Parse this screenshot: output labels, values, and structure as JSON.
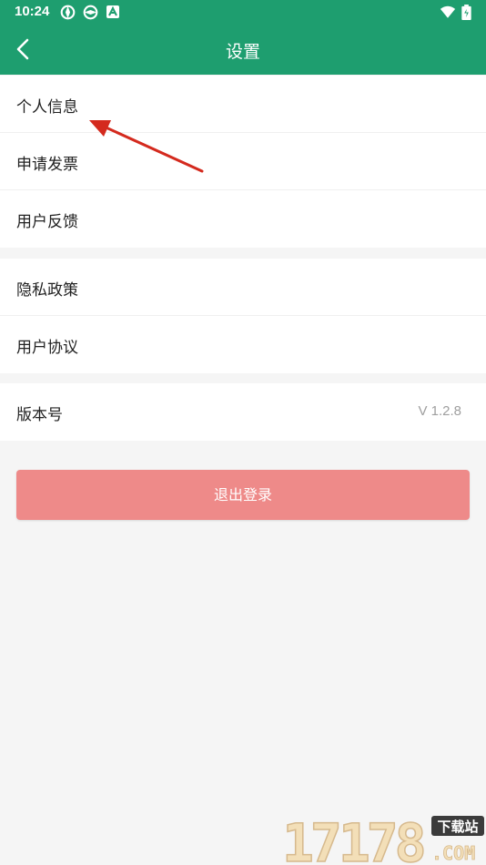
{
  "status_bar": {
    "time": "10:24"
  },
  "app_bar": {
    "title": "设置",
    "back_icon": "chevron-left-icon"
  },
  "groups": [
    {
      "items": [
        {
          "label": "个人信息"
        },
        {
          "label": "申请发票"
        },
        {
          "label": "用户反馈"
        }
      ]
    },
    {
      "items": [
        {
          "label": "隐私政策"
        },
        {
          "label": "用户协议"
        }
      ]
    },
    {
      "items": [
        {
          "label": "版本号",
          "value": "V 1.2.8"
        }
      ]
    }
  ],
  "logout_label": "退出登录",
  "watermark": {
    "text": "17178",
    "badge": "下载站",
    "suffix": ".COM"
  },
  "colors": {
    "header": "#1e9e6f",
    "logout": "#ee8a89",
    "annotation_arrow": "#d42a1e"
  }
}
